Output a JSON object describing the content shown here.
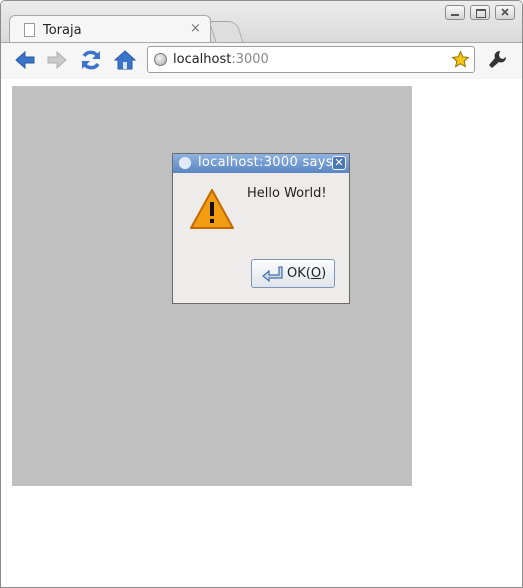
{
  "browser": {
    "tab_title": "Toraja",
    "tab_close": "×",
    "url_host": "localhost",
    "url_port": ":3000"
  },
  "dialog": {
    "title": "localhost:3000 says",
    "close_glyph": "✕",
    "message": "Hello World!",
    "ok_label_prefix": "OK(",
    "ok_label_mnemonic": "O",
    "ok_label_suffix": ")"
  },
  "icons": {
    "back": "back-arrow-icon",
    "forward": "forward-arrow-icon",
    "reload": "reload-icon",
    "home": "home-icon",
    "page": "globe-icon",
    "bookmark": "star-icon",
    "menu": "wrench-icon",
    "warning": "warning-icon"
  },
  "colors": {
    "page_background": "#c0c0c0",
    "dialog_title_bar": "#6a93cf",
    "warning": "#f39c12",
    "nav_blue": "#3b74c9"
  }
}
